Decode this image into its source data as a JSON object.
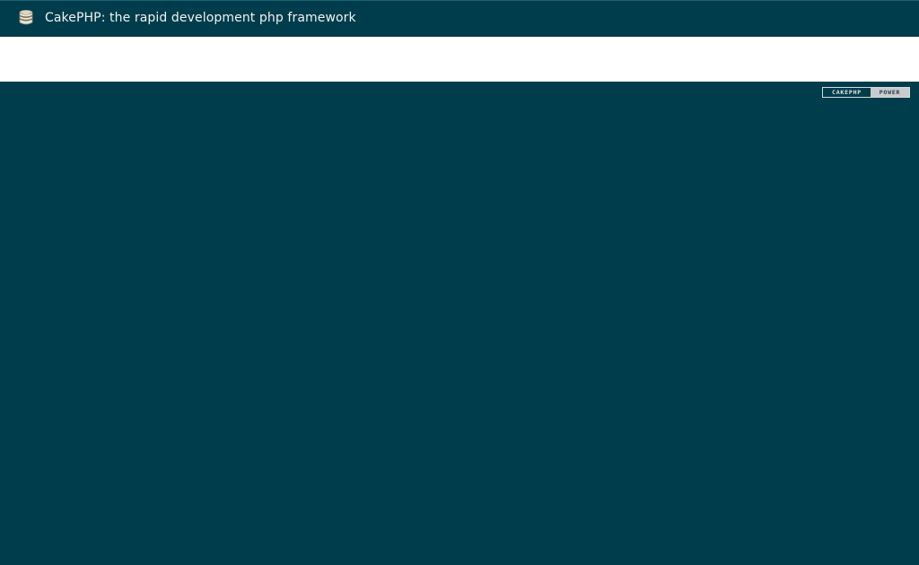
{
  "header": {
    "title": "CakePHP: the rapid development php framework",
    "logo_icon": "cake-icon"
  },
  "footer": {
    "badge": {
      "left_text": "CAKEPHP",
      "right_text": "POWER"
    }
  },
  "colors": {
    "background": "#003d4c",
    "content": "#ffffff"
  }
}
